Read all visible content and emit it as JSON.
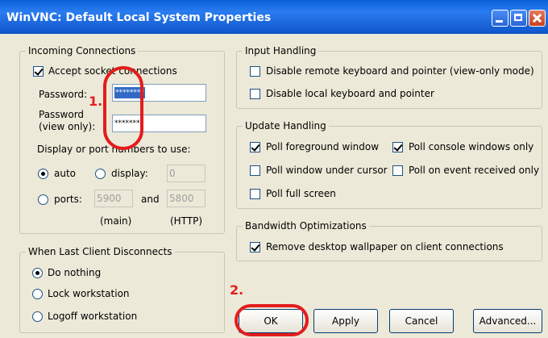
{
  "window": {
    "title": "WinVNC: Default Local System Properties"
  },
  "incoming": {
    "legend": "Incoming Connections",
    "accept_label": "Accept socket connections",
    "password_label": "Password:",
    "password_value": "********",
    "password_viewonly_label_1": "Password",
    "password_viewonly_label_2": "(view only):",
    "password_viewonly_value": "********",
    "display_port_label": "Display or port numbers to use:",
    "auto_label": "auto",
    "display_label": "display:",
    "display_value": "0",
    "ports_label": "ports:",
    "main_port_value": "5900",
    "and_label": "and",
    "http_port_value": "5800",
    "main_caption": "(main)",
    "http_caption": "(HTTP)"
  },
  "disconnect": {
    "legend": "When Last Client Disconnects",
    "options": [
      "Do nothing",
      "Lock workstation",
      "Logoff workstation"
    ]
  },
  "input_handling": {
    "legend": "Input Handling",
    "disable_remote": "Disable remote keyboard and pointer (view-only mode)",
    "disable_local": "Disable local keyboard and pointer"
  },
  "update_handling": {
    "legend": "Update Handling",
    "poll_foreground": "Poll foreground window",
    "poll_console": "Poll console windows only",
    "poll_under_cursor": "Poll window under cursor",
    "poll_on_event": "Poll on event received only",
    "poll_full_screen": "Poll full screen"
  },
  "bandwidth": {
    "legend": "Bandwidth Optimizations",
    "remove_wallpaper": "Remove desktop wallpaper on client connections"
  },
  "buttons": {
    "ok": "OK",
    "apply": "Apply",
    "cancel": "Cancel",
    "advanced": "Advanced..."
  },
  "annotations": {
    "step1": "1.",
    "step2": "2."
  },
  "colors": {
    "annotation": "#e31d1d",
    "titlebar": "#0a5fd8",
    "selection": "#316ac5"
  }
}
